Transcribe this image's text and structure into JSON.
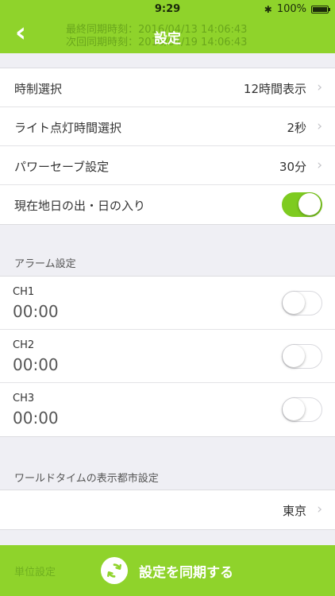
{
  "status_bar": {
    "time": "9:29",
    "battery": "100%",
    "battery_level": 1.0
  },
  "header": {
    "title": "設定",
    "last_sync": "最終同期時刻：2016/04/13 14:06:43",
    "next_sync": "次回同期時刻：2016/04/19 14:06:43"
  },
  "general": {
    "time_format": {
      "label": "時制選択",
      "value": "12時間表示"
    },
    "light_duration": {
      "label": "ライト点灯時間選択",
      "value": "2秒"
    },
    "power_save": {
      "label": "パワーセーブ設定",
      "value": "30分"
    },
    "sunrise_sunset": {
      "label": "現在地日の出・日の入り",
      "on": true
    }
  },
  "alarm": {
    "section_title": "アラーム設定",
    "items": [
      {
        "channel": "CH1",
        "time": "00:00",
        "on": false
      },
      {
        "channel": "CH2",
        "time": "00:00",
        "on": false
      },
      {
        "channel": "CH3",
        "time": "00:00",
        "on": false
      }
    ]
  },
  "world_time": {
    "section_title": "ワールドタイムの表示都市設定",
    "city": "東京"
  },
  "units": {
    "section_title": "単位設定"
  },
  "sync_button": {
    "label": "設定を同期する"
  },
  "colors": {
    "accent": "#8fd32b",
    "toggle_on": "#7ecb20"
  }
}
